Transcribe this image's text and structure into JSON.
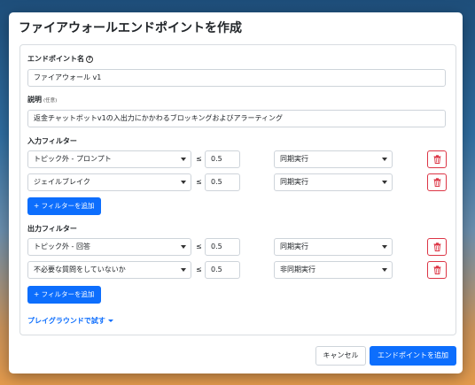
{
  "dialog": {
    "title": "ファイアウォールエンドポイントを作成",
    "help_icon": "question-circle-icon"
  },
  "endpoint_name": {
    "label": "エンドポイント名",
    "value": "ファイアウォール v1"
  },
  "description": {
    "label": "説明",
    "optional": "(任意)",
    "value": "返金チャットボットv1の入出力にかかわるブロッキングおよびアラーティング"
  },
  "input_filters": {
    "label": "入力フィルター",
    "rows": [
      {
        "type": "トピック外 - プロンプト",
        "operator": "≤",
        "threshold": "0.5",
        "mode": "同期実行"
      },
      {
        "type": "ジェイルブレイク",
        "operator": "≤",
        "threshold": "0.5",
        "mode": "同期実行"
      }
    ],
    "add_label": "+ フィルターを追加"
  },
  "output_filters": {
    "label": "出力フィルター",
    "rows": [
      {
        "type": "トピック外 - 回答",
        "operator": "≤",
        "threshold": "0.5",
        "mode": "同期実行"
      },
      {
        "type": "不必要な質問をしていないか",
        "operator": "≤",
        "threshold": "0.5",
        "mode": "非同期実行"
      }
    ],
    "add_label": "+ フィルターを追加"
  },
  "playground": {
    "label": "プレイグラウンドで試す"
  },
  "footer": {
    "cancel_label": "キャンセル",
    "submit_label": "エンドポイントを追加"
  },
  "colors": {
    "primary": "#0d6efd",
    "danger": "#dc3545"
  }
}
